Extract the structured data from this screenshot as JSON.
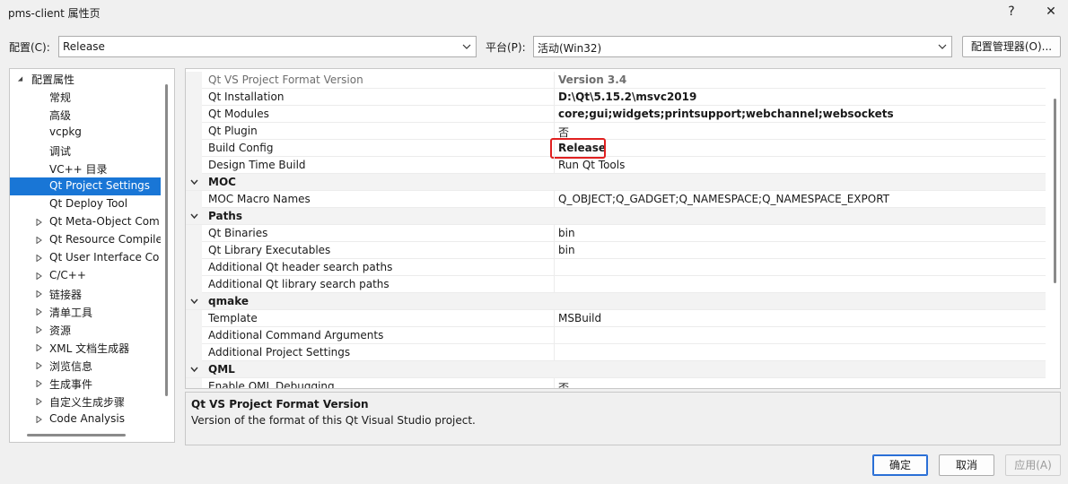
{
  "window": {
    "title": "pms-client 属性页",
    "help_label": "?",
    "close_label": "✕"
  },
  "config_bar": {
    "config_label": "配置(C):",
    "config_value": "Release",
    "platform_label": "平台(P):",
    "platform_value": "活动(Win32)",
    "manager_button": "配置管理器(O)..."
  },
  "tree": {
    "root": "配置属性",
    "items": [
      {
        "label": "常规",
        "expandable": false
      },
      {
        "label": "高级",
        "expandable": false
      },
      {
        "label": "vcpkg",
        "expandable": false
      },
      {
        "label": "调试",
        "expandable": false
      },
      {
        "label": "VC++ 目录",
        "expandable": false
      },
      {
        "label": "Qt Project Settings",
        "expandable": false,
        "selected": true
      },
      {
        "label": "Qt Deploy Tool",
        "expandable": false
      },
      {
        "label": "Qt Meta-Object Com",
        "expandable": true
      },
      {
        "label": "Qt Resource Compile",
        "expandable": true
      },
      {
        "label": "Qt User Interface Co",
        "expandable": true
      },
      {
        "label": "C/C++",
        "expandable": true
      },
      {
        "label": "链接器",
        "expandable": true
      },
      {
        "label": "清单工具",
        "expandable": true
      },
      {
        "label": "资源",
        "expandable": true
      },
      {
        "label": "XML 文档生成器",
        "expandable": true
      },
      {
        "label": "浏览信息",
        "expandable": true
      },
      {
        "label": "生成事件",
        "expandable": true
      },
      {
        "label": "自定义生成步骤",
        "expandable": true
      },
      {
        "label": "Code Analysis",
        "expandable": true
      }
    ]
  },
  "grid": {
    "rows": [
      {
        "kind": "prop",
        "name": "Qt VS Project Format Version",
        "value": "Version 3.4",
        "bold": true,
        "dim": true
      },
      {
        "kind": "prop",
        "name": "Qt Installation",
        "value": "D:\\Qt\\5.15.2\\msvc2019",
        "bold": true
      },
      {
        "kind": "prop",
        "name": "Qt Modules",
        "value": "core;gui;widgets;printsupport;webchannel;websockets",
        "bold": true
      },
      {
        "kind": "prop",
        "name": "Qt Plugin",
        "value": "否"
      },
      {
        "kind": "prop",
        "name": "Build Config",
        "value": "Release",
        "bold": true,
        "highlight": true
      },
      {
        "kind": "prop",
        "name": "Design Time Build",
        "value": "Run Qt Tools"
      },
      {
        "kind": "cat",
        "name": "MOC"
      },
      {
        "kind": "prop",
        "name": "MOC Macro Names",
        "value": "Q_OBJECT;Q_GADGET;Q_NAMESPACE;Q_NAMESPACE_EXPORT"
      },
      {
        "kind": "cat",
        "name": "Paths"
      },
      {
        "kind": "prop",
        "name": "Qt Binaries",
        "value": "bin"
      },
      {
        "kind": "prop",
        "name": "Qt Library Executables",
        "value": "bin"
      },
      {
        "kind": "prop",
        "name": "Additional Qt header search paths",
        "value": ""
      },
      {
        "kind": "prop",
        "name": "Additional Qt library search paths",
        "value": ""
      },
      {
        "kind": "cat",
        "name": "qmake"
      },
      {
        "kind": "prop",
        "name": "Template",
        "value": "MSBuild"
      },
      {
        "kind": "prop",
        "name": "Additional Command Arguments",
        "value": ""
      },
      {
        "kind": "prop",
        "name": "Additional Project Settings",
        "value": ""
      },
      {
        "kind": "cat",
        "name": "QML"
      },
      {
        "kind": "prop",
        "name": "Enable QML Debugging",
        "value": "否"
      }
    ]
  },
  "description": {
    "title": "Qt VS Project Format Version",
    "text": "Version of the format of this Qt Visual Studio project."
  },
  "footer": {
    "ok": "确定",
    "cancel": "取消",
    "apply": "应用(A)"
  },
  "colors": {
    "selection": "#1976d6",
    "highlight_border": "#e02020",
    "primary_border": "#2a6fd6"
  }
}
